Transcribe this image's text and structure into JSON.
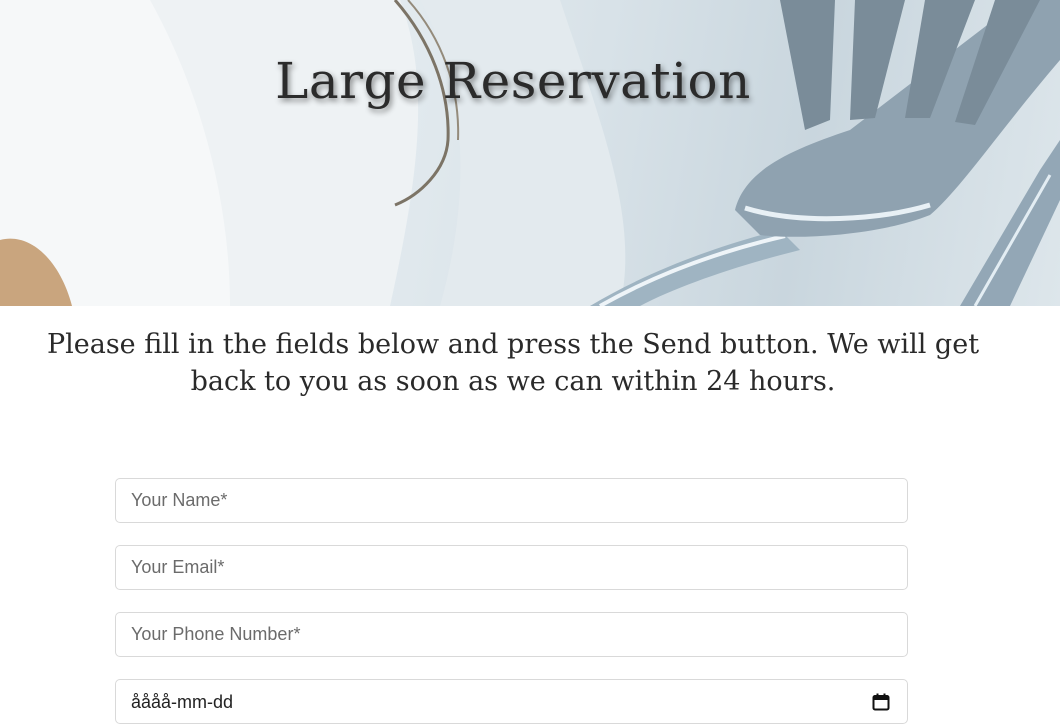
{
  "hero": {
    "title": "Large Reservation"
  },
  "intro": {
    "text": "Please fill in the fields below and press the Send button. We will get back to you as soon as we can within 24 hours."
  },
  "form": {
    "name_placeholder": "Your Name*",
    "email_placeholder": "Your Email*",
    "phone_placeholder": "Your Phone Number*",
    "date_value": "åååå-mm-dd",
    "date_icon": "calendar-icon"
  }
}
